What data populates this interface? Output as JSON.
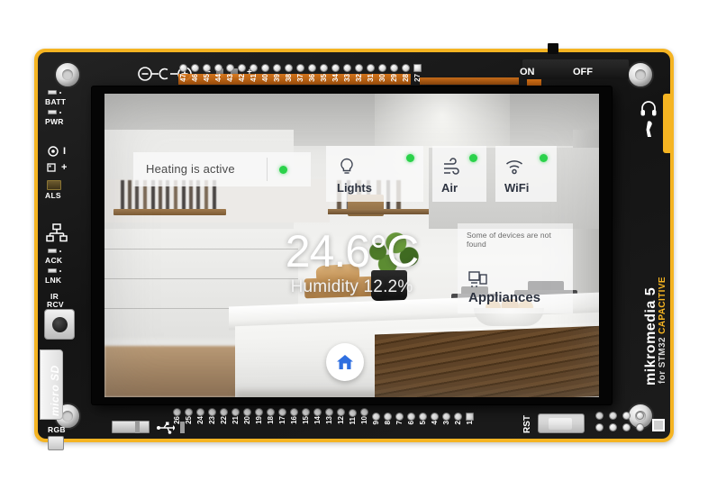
{
  "device": {
    "brand_line1": "mikromedia 5",
    "brand_line2": "for STM32",
    "brand_line3": "CAPACITIVE",
    "power_switch": {
      "on_label": "ON",
      "off_label": "OFF"
    },
    "polarity_minus": "−",
    "polarity_plus": "+",
    "reset_label": "RST",
    "sd_label": "micro SD",
    "left_labels": [
      {
        "name": "batt",
        "text": "BATT"
      },
      {
        "name": "pwr",
        "text": "PWR"
      },
      {
        "name": "als",
        "text": "ALS"
      },
      {
        "name": "ack",
        "text": "ACK"
      },
      {
        "name": "lnk",
        "text": "LNK"
      },
      {
        "name": "ir",
        "text": "IR"
      },
      {
        "name": "rcv",
        "text": "RCV"
      },
      {
        "name": "rgb",
        "text": "RGB"
      }
    ],
    "top_header_pins": [
      "47",
      "46",
      "45",
      "44",
      "43",
      "42",
      "41",
      "40",
      "39",
      "38",
      "37",
      "36",
      "35",
      "34",
      "33",
      "32",
      "31",
      "30",
      "29",
      "28",
      "27"
    ],
    "bottom_header_pins": [
      "26",
      "25",
      "24",
      "23",
      "22",
      "21",
      "20",
      "19",
      "18",
      "17",
      "16",
      "15",
      "14",
      "13",
      "12",
      "11",
      "10",
      "9",
      "8",
      "7",
      "6",
      "5",
      "4",
      "3",
      "2",
      "1"
    ]
  },
  "screen": {
    "heating_card": {
      "label": "Heating is active",
      "status_color": "#2ad24a"
    },
    "tiles": [
      {
        "label": "Lights",
        "icon": "lightbulb-icon",
        "status_color": "#2ad24a"
      },
      {
        "label": "Air",
        "icon": "air-flow-icon",
        "status_color": "#2ad24a"
      },
      {
        "label": "WiFi",
        "icon": "wifi-icon",
        "status_color": "#2ad24a"
      }
    ],
    "temperature": "24.6°C",
    "humidity": "Humidity 12.2%",
    "appliances_card": {
      "note": "Some of devices are not found",
      "label": "Appliances",
      "icon": "appliance-icon"
    },
    "home_button": {
      "icon": "home-icon",
      "icon_color": "#2f6fe0"
    }
  }
}
